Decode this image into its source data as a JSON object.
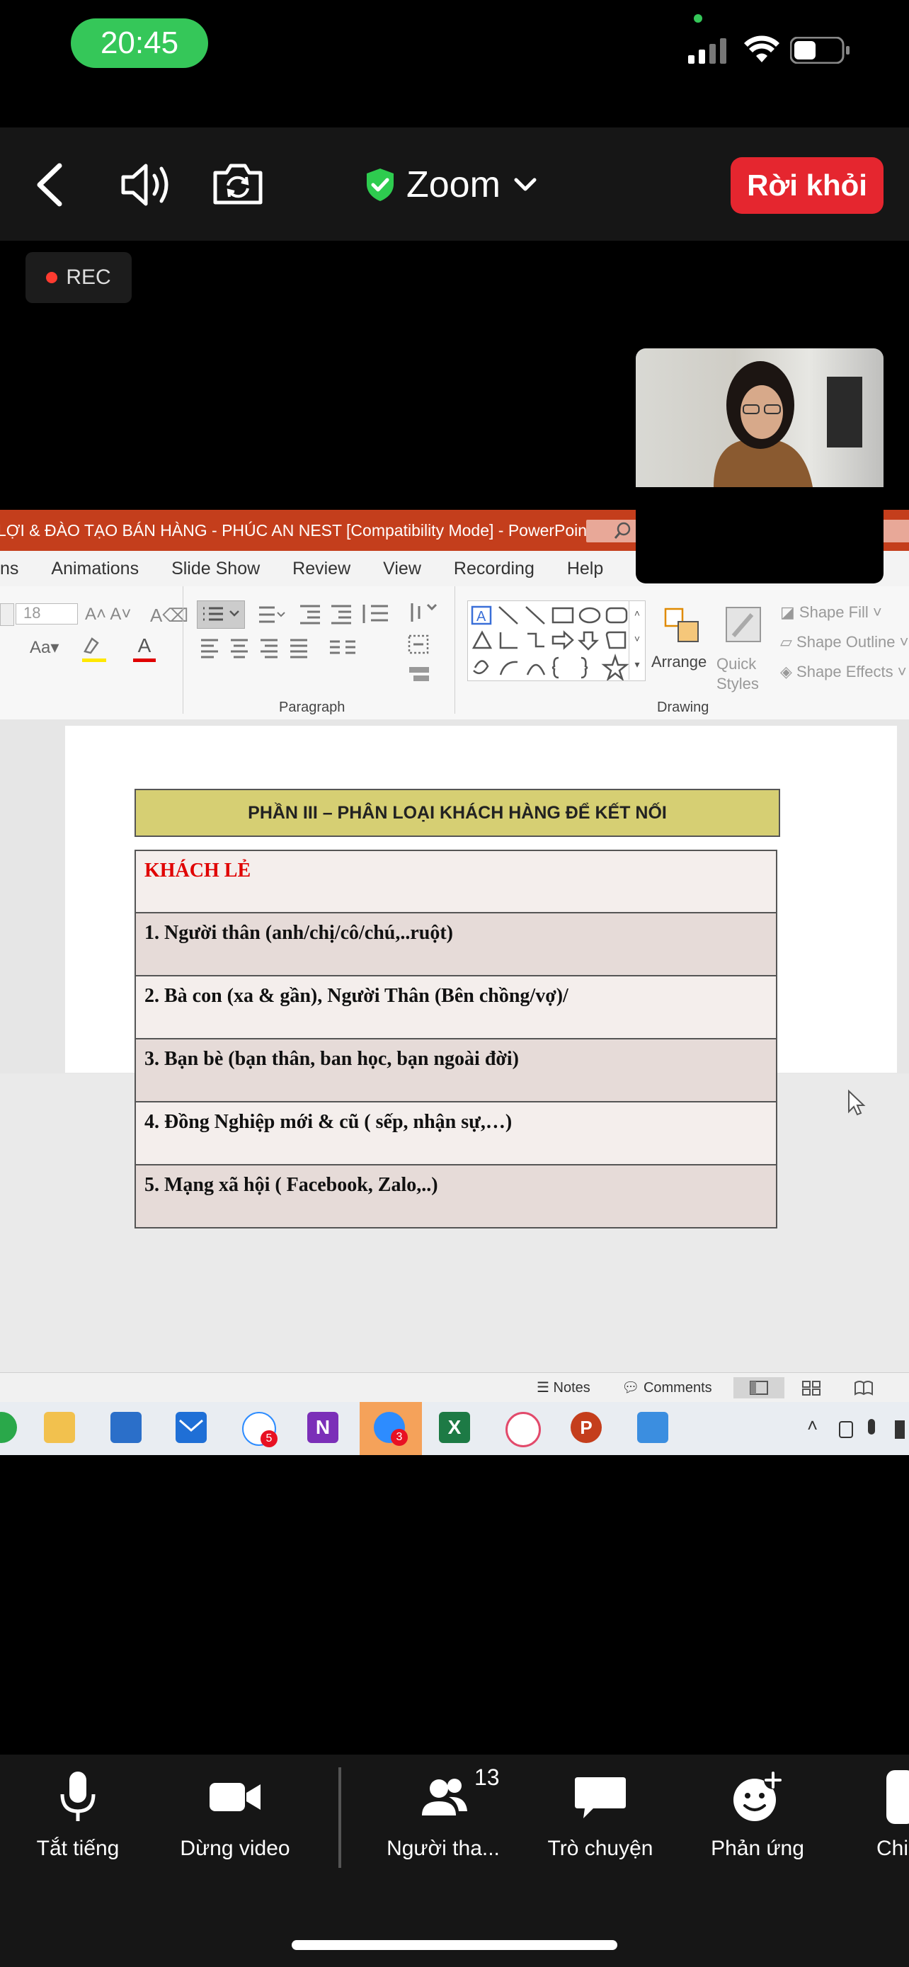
{
  "status": {
    "time": "20:45"
  },
  "topbar": {
    "title": "Zoom",
    "leave_label": "Rời khỏi"
  },
  "rec": {
    "label": "REC"
  },
  "ppt": {
    "window_title": "LỢI & ĐÀO TẠO BÁN HÀNG - PHÚC AN NEST [Compatibility Mode]  -  PowerPoint",
    "menu": [
      "ns",
      "Animations",
      "Slide Show",
      "Review",
      "View",
      "Recording",
      "Help"
    ],
    "ribbon": {
      "font_size": "18",
      "paragraph_label": "Paragraph",
      "drawing_label": "Drawing",
      "arrange_label": "Arrange",
      "quick_styles_label": "Quick Styles",
      "shape_fill": "Shape Fill",
      "shape_outline": "Shape Outline",
      "shape_effects": "Shape Effects"
    },
    "slide": {
      "header": "PHẦN III – PHÂN LOẠI KHÁCH HÀNG ĐỂ KẾT NỐI",
      "rows": [
        "KHÁCH LẺ",
        "1.   Người thân  (anh/chị/cô/chú,..ruột)",
        "2. Bà con (xa & gần), Người Thân (Bên chồng/vợ)/",
        "3. Bạn bè (bạn thân, ban học, bạn ngoài đời)",
        "4. Đồng Nghiệp mới & cũ ( sếp, nhận sự,…)",
        "5. Mạng xã hội ( Facebook, Zalo,..)"
      ]
    },
    "statusbar": {
      "notes": "Notes",
      "comments": "Comments"
    },
    "taskbar": {
      "badge_zalo": "5",
      "badge_zoom": "3"
    }
  },
  "bottombar": {
    "mute": "Tắt tiếng",
    "video": "Dừng video",
    "participants": "Người tha...",
    "participants_count": "13",
    "chat": "Trò chuyện",
    "reactions": "Phản ứng",
    "more": "Chi"
  }
}
